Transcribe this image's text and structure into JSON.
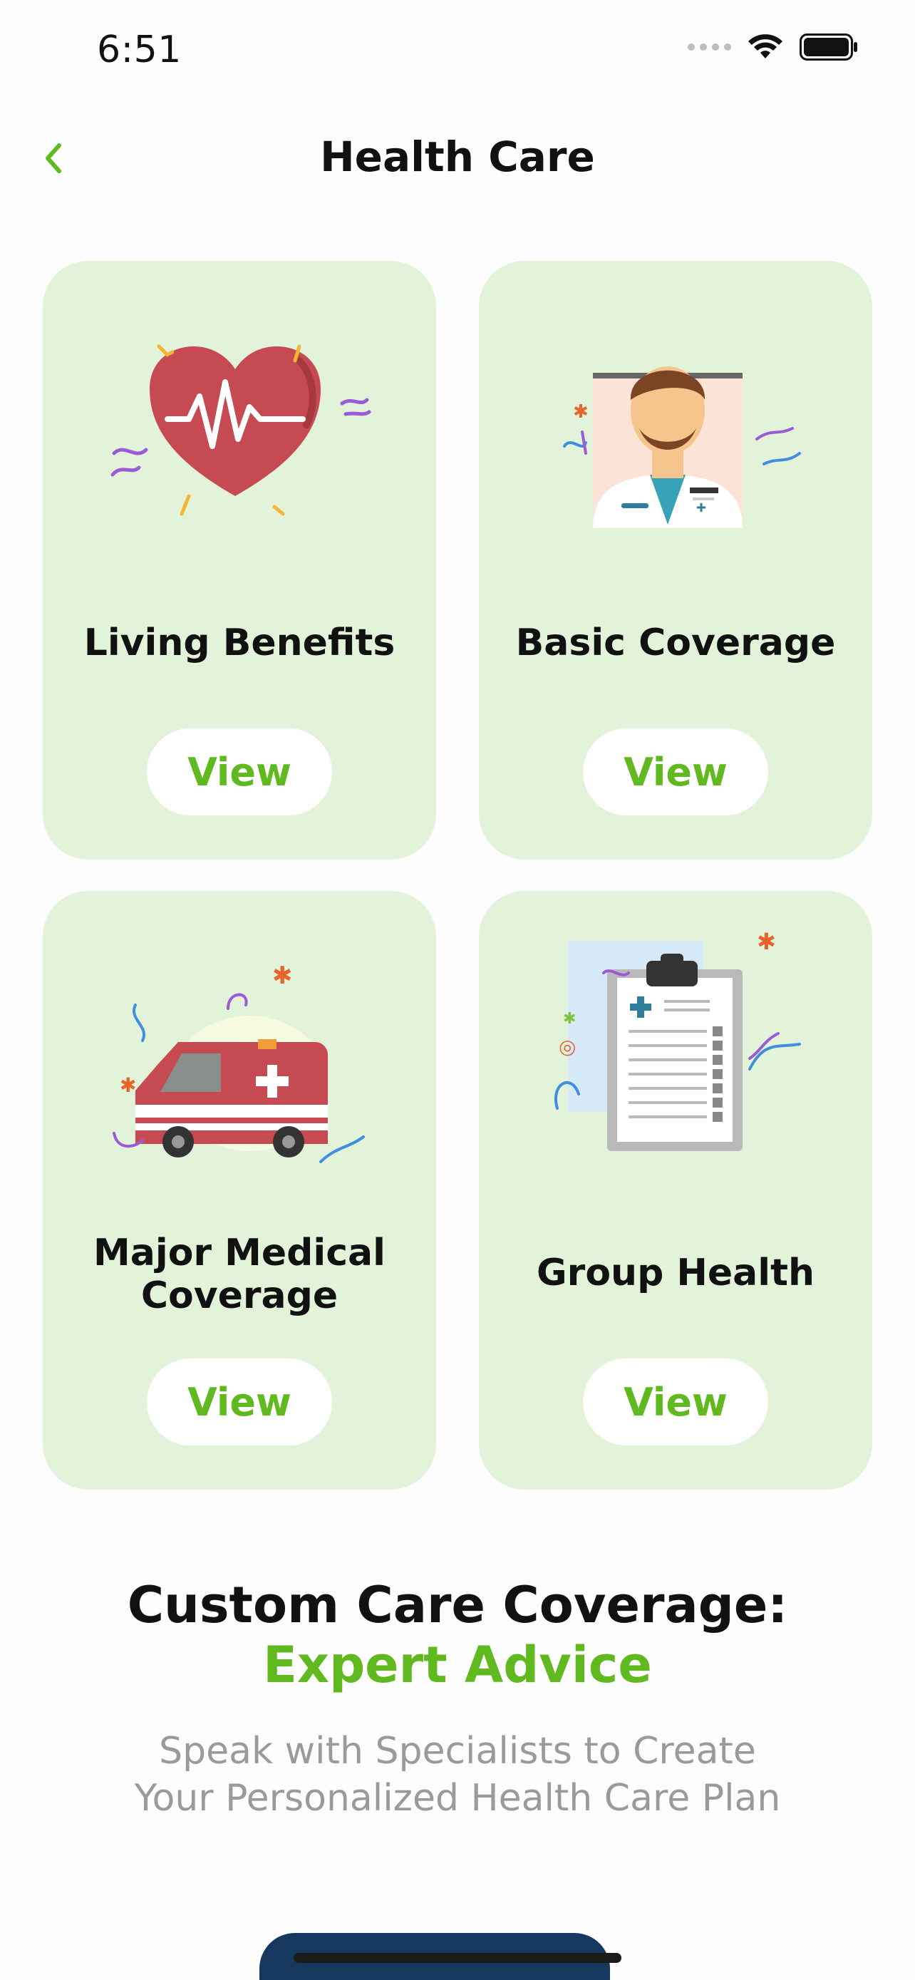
{
  "status_bar": {
    "time": "6:51"
  },
  "nav": {
    "title": "Health Care"
  },
  "cards": [
    {
      "title": "Living Benefits",
      "button": "View",
      "icon": "heart-pulse-icon"
    },
    {
      "title": "Basic Coverage",
      "button": "View",
      "icon": "doctor-icon"
    },
    {
      "title": "Major Medical Coverage",
      "title_line1": "Major Medical",
      "title_line2": "Coverage",
      "button": "View",
      "icon": "ambulance-icon"
    },
    {
      "title": "Group Health",
      "button": "View",
      "icon": "clipboard-icon"
    }
  ],
  "promo": {
    "title": "Custom Care Coverage:",
    "accent": "Expert Advice",
    "subtitle_line1": "Speak with Specialists to Create",
    "subtitle_line2": "Your Personalized Health Care Plan"
  },
  "colors": {
    "accent": "#5fb91f",
    "card_bg": "#e3f3da",
    "bottom_button": "#17385e"
  }
}
